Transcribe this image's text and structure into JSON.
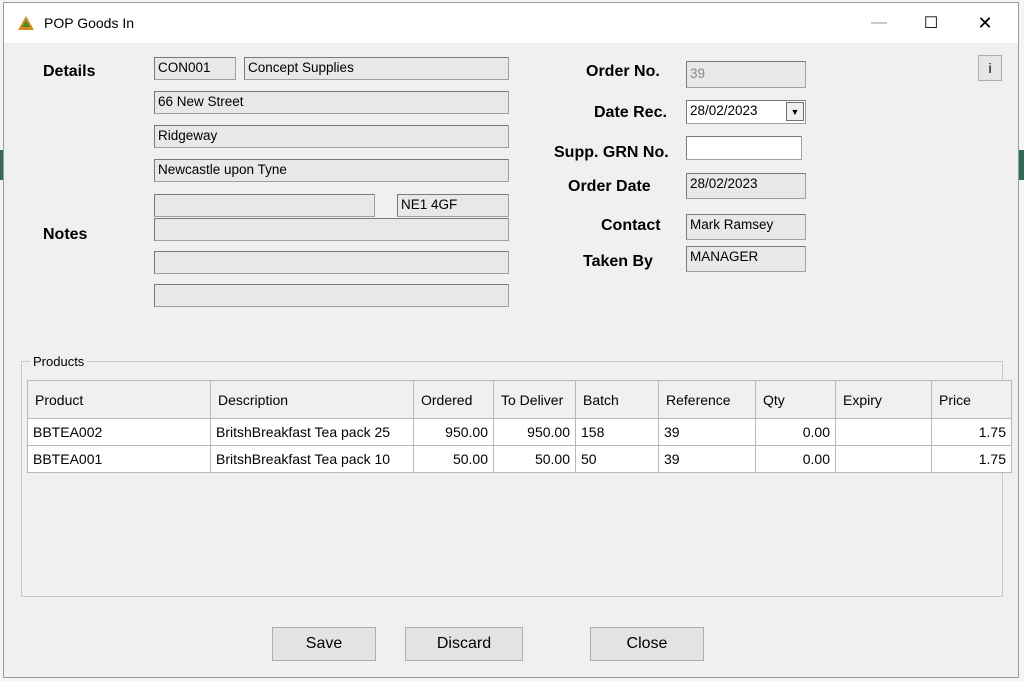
{
  "window": {
    "title": "POP Goods In",
    "min_glyph": "—",
    "max_glyph": "☐",
    "close_glyph": "✕"
  },
  "labels": {
    "details": "Details",
    "notes": "Notes",
    "order_no": "Order No.",
    "date_rec": "Date Rec.",
    "supp_grn": "Supp. GRN No.",
    "order_date": "Order Date",
    "contact": "Contact",
    "taken_by": "Taken By"
  },
  "supplier": {
    "code": "CON001",
    "name": "Concept Supplies",
    "address1": "66 New Street",
    "address2": "Ridgeway",
    "address3": "Newcastle upon Tyne",
    "address4": "",
    "postcode": "NE1 4GF"
  },
  "notes": [
    "",
    "",
    ""
  ],
  "order": {
    "order_no": "39",
    "date_rec": "28/02/2023",
    "supp_grn_no": "",
    "order_date": "28/02/2023",
    "contact": "Mark Ramsey",
    "taken_by": "MANAGER"
  },
  "info_button": "i",
  "products": {
    "group_title": "Products",
    "columns": [
      "Product",
      "Description",
      "Ordered",
      "To Deliver",
      "Batch",
      "Reference",
      "Qty",
      "Expiry",
      "Price"
    ],
    "rows": [
      [
        "BBTEA002",
        "BritshBreakfast  Tea pack 25",
        "950.00",
        "950.00",
        "158",
        "39",
        "0.00",
        "",
        "1.75"
      ],
      [
        "BBTEA001",
        "BritshBreakfast  Tea pack 10",
        "50.00",
        "50.00",
        "50",
        "39",
        "0.00",
        "",
        "1.75"
      ]
    ]
  },
  "buttons": {
    "save": "Save",
    "discard": "Discard",
    "close": "Close"
  },
  "icons": {
    "app": "app-icon",
    "dropdown": "chevron-down-icon"
  }
}
